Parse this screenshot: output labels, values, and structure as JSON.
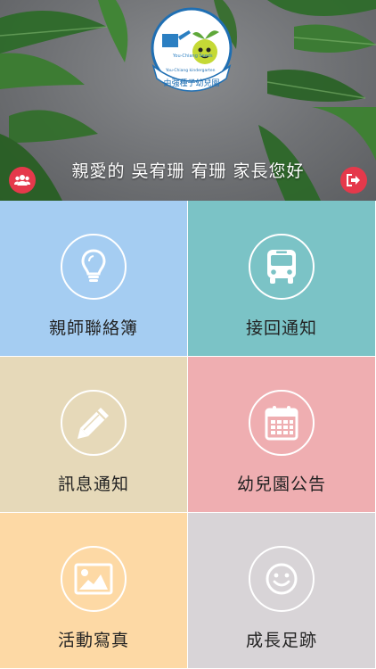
{
  "header": {
    "greeting": "親愛的 吳宥珊 宥珊 家長您好",
    "logo": {
      "brand_en": "You-Chiang Seeds",
      "arc_en": "You-Chiang kindergarten",
      "name": "由強種子幼兒園"
    },
    "left_button_icon": "users-icon",
    "right_button_icon": "sign-out-icon",
    "button_color": "#e5394b"
  },
  "tiles": [
    {
      "label": "親師聯絡簿",
      "icon": "lightbulb-icon",
      "color": "#a5cdf2"
    },
    {
      "label": "接回通知",
      "icon": "bus-icon",
      "color": "#7bc3c6"
    },
    {
      "label": "訊息通知",
      "icon": "pencil-icon",
      "color": "#e6d9b9"
    },
    {
      "label": "幼兒園公告",
      "icon": "calendar-icon",
      "color": "#efaeb1"
    },
    {
      "label": "活動寫真",
      "icon": "picture-icon",
      "color": "#fdd9a5"
    },
    {
      "label": "成長足跡",
      "icon": "smile-icon",
      "color": "#d8d4d7"
    }
  ]
}
